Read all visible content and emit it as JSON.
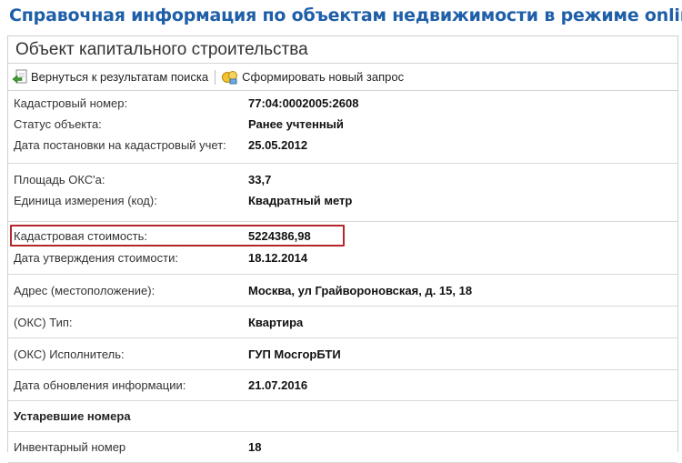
{
  "header": {
    "title": "Справочная информация по объектам недвижимости в режиме online"
  },
  "panel": {
    "title": "Объект капитального строительства"
  },
  "toolbar": {
    "back_label": "Вернуться к результатам поиска",
    "new_request_label": "Сформировать новый запрос"
  },
  "fields": {
    "cadastral_number": {
      "label": "Кадастровый номер:",
      "value": "77:04:0002005:2608"
    },
    "status": {
      "label": "Статус объекта:",
      "value": "Ранее учтенный"
    },
    "registration_date": {
      "label": "Дата постановки на кадастровый учет:",
      "value": "25.05.2012"
    },
    "area": {
      "label": "Площадь ОКС'а:",
      "value": "33,7"
    },
    "unit": {
      "label": "Единица измерения (код):",
      "value": "Квадратный метр"
    },
    "cadastral_value": {
      "label": "Кадастровая стоимость:",
      "value": "5224386,98"
    },
    "value_approval_date": {
      "label": "Дата утверждения стоимости:",
      "value": "18.12.2014"
    },
    "address": {
      "label": "Адрес (местоположение):",
      "value": "Москва, ул Грайвороновская, д. 15, 18"
    },
    "oks_type": {
      "label": "(ОКС) Тип:",
      "value": "Квартира"
    },
    "oks_executor": {
      "label": "(ОКС) Исполнитель:",
      "value": "ГУП МосгорБТИ"
    },
    "update_date": {
      "label": "Дата обновления информации:",
      "value": "21.07.2016"
    }
  },
  "obsolete": {
    "title": "Устаревшие номера",
    "inventory_number": {
      "label": "Инвентарный номер",
      "value": "18"
    }
  },
  "colors": {
    "title_blue": "#1f5fa8",
    "highlight_red": "#b3262b"
  }
}
